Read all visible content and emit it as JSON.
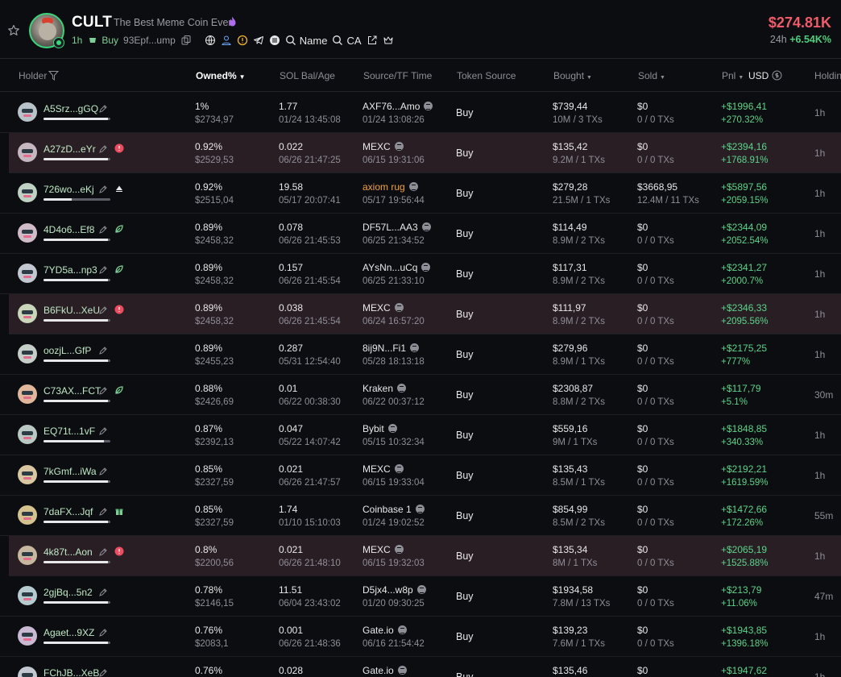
{
  "token": {
    "name": "CULT",
    "tagline": "The Best Meme Coin Ever!",
    "age": "1h",
    "buy_label": "Buy",
    "address": "93Epf...ump",
    "name_search": "Name",
    "ca_search": "CA",
    "price": "$274.81K",
    "change_label": "24h",
    "change_value": "+6.54K%"
  },
  "headers": {
    "holder": "Holder",
    "owned": "Owned%",
    "sol_bal": "SOL Bal/Age",
    "source": "Source/TF Time",
    "token_source": "Token Source",
    "bought": "Bought",
    "sold": "Sold",
    "pnl": "Pnl",
    "usd": "USD",
    "holding": "Holdin"
  },
  "rows": [
    {
      "name": "A5Srz...gGQ",
      "mark": "",
      "bar": 0.96,
      "flag": false,
      "owned": "1%",
      "owned_usd": "$2734,97",
      "sol": "1.77",
      "age": "01/24 13:45:08",
      "src": "AXF76...Amo",
      "src_warn": false,
      "src_time": "01/24 13:08:26",
      "tsrc": "Buy",
      "bought": "$739,44",
      "bought_tx": "10M / 3 TXs",
      "sold": "$0",
      "sold_tx": "0 / 0 TXs",
      "pnl": "+$1996,41",
      "pnl_pct": "+270.32%",
      "hold": "1h"
    },
    {
      "name": "A27zD...eYr",
      "mark": "alert",
      "bar": 0.96,
      "flag": true,
      "owned": "0.92%",
      "owned_usd": "$2529,53",
      "sol": "0.022",
      "age": "06/26 21:47:25",
      "src": "MEXC",
      "src_warn": false,
      "src_time": "06/15 19:31:06",
      "tsrc": "Buy",
      "bought": "$135,42",
      "bought_tx": "9.2M / 1 TXs",
      "sold": "$0",
      "sold_tx": "0 / 0 TXs",
      "pnl": "+$2394,16",
      "pnl_pct": "+1768.91%",
      "hold": "1h"
    },
    {
      "name": "726wo...eKj",
      "mark": "triangle",
      "bar": 0.42,
      "flag": false,
      "owned": "0.92%",
      "owned_usd": "$2515,04",
      "sol": "19.58",
      "age": "05/17 20:07:41",
      "src": "axiom rug",
      "src_warn": true,
      "src_time": "05/17 19:56:44",
      "tsrc": "Buy",
      "bought": "$279,28",
      "bought_tx": "21.5M / 1 TXs",
      "sold": "$3668,95",
      "sold_tx": "12.4M / 11 TXs",
      "pnl": "+$5897,56",
      "pnl_pct": "+2059.15%",
      "hold": "1h"
    },
    {
      "name": "4D4o6...Ef8",
      "mark": "leaf",
      "bar": 0.96,
      "flag": false,
      "owned": "0.89%",
      "owned_usd": "$2458,32",
      "sol": "0.078",
      "age": "06/26 21:45:53",
      "src": "DF57L...AA3",
      "src_warn": false,
      "src_time": "06/25 21:34:52",
      "tsrc": "Buy",
      "bought": "$114,49",
      "bought_tx": "8.9M / 2 TXs",
      "sold": "$0",
      "sold_tx": "0 / 0 TXs",
      "pnl": "+$2344,09",
      "pnl_pct": "+2052.54%",
      "hold": "1h"
    },
    {
      "name": "7YD5a...np3",
      "mark": "leaf",
      "bar": 0.96,
      "flag": false,
      "owned": "0.89%",
      "owned_usd": "$2458,32",
      "sol": "0.157",
      "age": "06/26 21:45:54",
      "src": "AYsNn...uCq",
      "src_warn": false,
      "src_time": "06/25 21:33:10",
      "tsrc": "Buy",
      "bought": "$117,31",
      "bought_tx": "8.9M / 2 TXs",
      "sold": "$0",
      "sold_tx": "0 / 0 TXs",
      "pnl": "+$2341,27",
      "pnl_pct": "+2000.7%",
      "hold": "1h"
    },
    {
      "name": "B6FkU...XeU",
      "mark": "alert",
      "bar": 0.96,
      "flag": true,
      "owned": "0.89%",
      "owned_usd": "$2458,32",
      "sol": "0.038",
      "age": "06/26 21:45:54",
      "src": "MEXC",
      "src_warn": false,
      "src_time": "06/24 16:57:20",
      "tsrc": "Buy",
      "bought": "$111,97",
      "bought_tx": "8.9M / 2 TXs",
      "sold": "$0",
      "sold_tx": "0 / 0 TXs",
      "pnl": "+$2346,33",
      "pnl_pct": "+2095.56%",
      "hold": "1h"
    },
    {
      "name": "oozjL...GfP",
      "mark": "",
      "bar": 0.96,
      "flag": false,
      "owned": "0.89%",
      "owned_usd": "$2455,23",
      "sol": "0.287",
      "age": "05/31 12:54:40",
      "src": "8ij9N...Fi1",
      "src_warn": false,
      "src_time": "05/28 18:13:18",
      "tsrc": "Buy",
      "bought": "$279,96",
      "bought_tx": "8.9M / 1 TXs",
      "sold": "$0",
      "sold_tx": "0 / 0 TXs",
      "pnl": "+$2175,25",
      "pnl_pct": "+777%",
      "hold": "1h"
    },
    {
      "name": "C73AX...FCT",
      "mark": "leaf",
      "bar": 0.96,
      "flag": false,
      "owned": "0.88%",
      "owned_usd": "$2426,69",
      "sol": "0.01",
      "age": "06/22 00:38:30",
      "src": "Kraken",
      "src_warn": false,
      "src_time": "06/22 00:37:12",
      "tsrc": "Buy",
      "bought": "$2308,87",
      "bought_tx": "8.8M / 2 TXs",
      "sold": "$0",
      "sold_tx": "0 / 0 TXs",
      "pnl": "+$117,79",
      "pnl_pct": "+5.1%",
      "hold": "30m"
    },
    {
      "name": "EQ71t...1vF",
      "mark": "",
      "bar": 0.9,
      "flag": false,
      "owned": "0.87%",
      "owned_usd": "$2392,13",
      "sol": "0.047",
      "age": "05/22 14:07:42",
      "src": "Bybit",
      "src_warn": false,
      "src_time": "05/15 10:32:34",
      "tsrc": "Buy",
      "bought": "$559,16",
      "bought_tx": "9M / 1 TXs",
      "sold": "$0",
      "sold_tx": "0 / 0 TXs",
      "pnl": "+$1848,85",
      "pnl_pct": "+340.33%",
      "hold": "1h"
    },
    {
      "name": "7kGmf...iWa",
      "mark": "",
      "bar": 0.96,
      "flag": false,
      "owned": "0.85%",
      "owned_usd": "$2327,59",
      "sol": "0.021",
      "age": "06/26 21:47:57",
      "src": "MEXC",
      "src_warn": false,
      "src_time": "06/15 19:33:04",
      "tsrc": "Buy",
      "bought": "$135,43",
      "bought_tx": "8.5M / 1 TXs",
      "sold": "$0",
      "sold_tx": "0 / 0 TXs",
      "pnl": "+$2192,21",
      "pnl_pct": "+1619.59%",
      "hold": "1h"
    },
    {
      "name": "7daFX...Jqf",
      "mark": "gift",
      "bar": 0.96,
      "flag": false,
      "owned": "0.85%",
      "owned_usd": "$2327,59",
      "sol": "1.74",
      "age": "01/10 15:10:03",
      "src": "Coinbase 1",
      "src_warn": false,
      "src_time": "01/24 19:02:52",
      "tsrc": "Buy",
      "bought": "$854,99",
      "bought_tx": "8.5M / 2 TXs",
      "sold": "$0",
      "sold_tx": "0 / 0 TXs",
      "pnl": "+$1472,66",
      "pnl_pct": "+172.26%",
      "hold": "55m"
    },
    {
      "name": "4k87t...Aon",
      "mark": "alert",
      "bar": 0.96,
      "flag": true,
      "owned": "0.8%",
      "owned_usd": "$2200,56",
      "sol": "0.021",
      "age": "06/26 21:48:10",
      "src": "MEXC",
      "src_warn": false,
      "src_time": "06/15 19:32:03",
      "tsrc": "Buy",
      "bought": "$135,34",
      "bought_tx": "8M / 1 TXs",
      "sold": "$0",
      "sold_tx": "0 / 0 TXs",
      "pnl": "+$2065,19",
      "pnl_pct": "+1525.88%",
      "hold": "1h"
    },
    {
      "name": "2gjBq...5n2",
      "mark": "",
      "bar": 0.96,
      "flag": false,
      "owned": "0.78%",
      "owned_usd": "$2146,15",
      "sol": "11.51",
      "age": "06/04 23:43:02",
      "src": "D5jx4...w8p",
      "src_warn": false,
      "src_time": "01/20 09:30:25",
      "tsrc": "Buy",
      "bought": "$1934,58",
      "bought_tx": "7.8M / 13 TXs",
      "sold": "$0",
      "sold_tx": "0 / 0 TXs",
      "pnl": "+$213,79",
      "pnl_pct": "+11.06%",
      "hold": "47m"
    },
    {
      "name": "Agaet...9XZ",
      "mark": "",
      "bar": 0.96,
      "flag": false,
      "owned": "0.76%",
      "owned_usd": "$2083,1",
      "sol": "0.001",
      "age": "06/26 21:48:36",
      "src": "Gate.io",
      "src_warn": false,
      "src_time": "06/16 21:54:42",
      "tsrc": "Buy",
      "bought": "$139,23",
      "bought_tx": "7.6M / 1 TXs",
      "sold": "$0",
      "sold_tx": "0 / 0 TXs",
      "pnl": "+$1943,85",
      "pnl_pct": "+1396.18%",
      "hold": "1h"
    },
    {
      "name": "FChJB...XeB",
      "mark": "",
      "bar": 0.96,
      "flag": false,
      "owned": "0.76%",
      "owned_usd": "",
      "sol": "0.028",
      "age": "",
      "src": "Gate.io",
      "src_warn": false,
      "src_time": "",
      "tsrc": "Buy",
      "bought": "$135,46",
      "bought_tx": "",
      "sold": "$0",
      "sold_tx": "",
      "pnl": "+$1947,62",
      "pnl_pct": "",
      "hold": "1h"
    }
  ],
  "colors": {
    "positive": "#5ad48a",
    "price_red": "#ef5b6b",
    "flag_row_bg": "#2a1e25",
    "alert": "#ef4d5f",
    "warn_source": "#f3a23f"
  },
  "icons": {
    "star": "star-icon",
    "filter": "filter-icon",
    "pencil": "pencil-icon",
    "alert": "alert-icon",
    "leaf": "leaf-icon",
    "gift": "gift-icon",
    "triangle": "triangle-icon"
  }
}
